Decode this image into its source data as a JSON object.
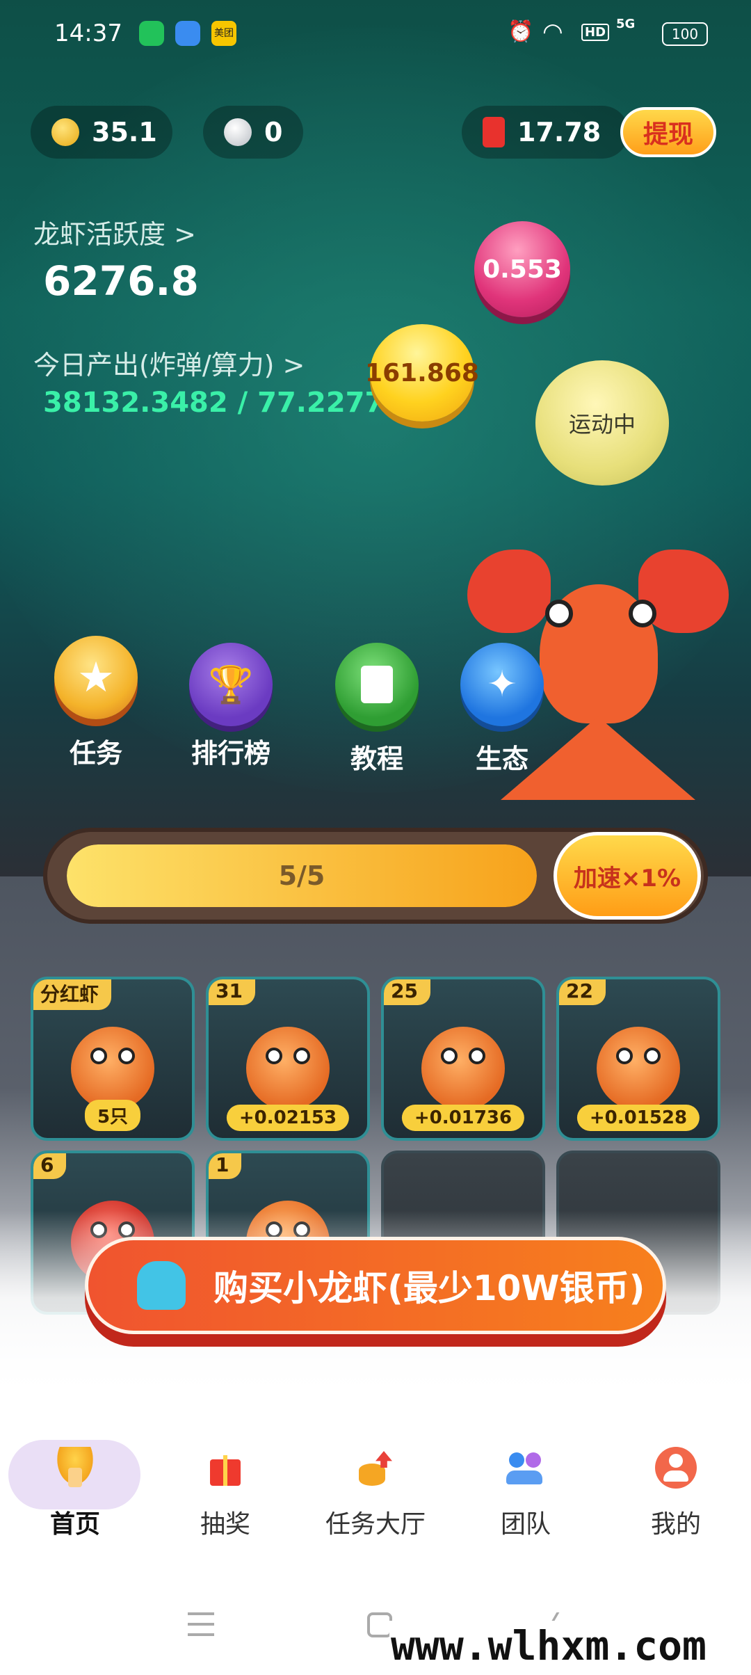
{
  "status_bar": {
    "time": "14:37",
    "app_icon_label": "美团",
    "battery": "100",
    "signal": "5G",
    "hd": "HD"
  },
  "wallet": {
    "gold": "35.1",
    "silver": "0",
    "redpacket": "17.78",
    "withdraw_label": "提现"
  },
  "stats": {
    "activity_label": "龙虾活跃度 >",
    "activity_value": "6276.8",
    "output_label": "今日产出(炸弹/算力) >",
    "output_value": "38132.3482 / 77.2277"
  },
  "bubbles": {
    "pink": "0.553",
    "yellow": "161.868",
    "status": "运动中"
  },
  "quick_actions": [
    {
      "label": "任务",
      "icon": "star-icon"
    },
    {
      "label": "排行榜",
      "icon": "trophy-icon"
    },
    {
      "label": "教程",
      "icon": "document-icon"
    },
    {
      "label": "生态",
      "icon": "sparkle-icon"
    }
  ],
  "progress": {
    "text": "5/5",
    "level": 1.0,
    "boost_label": "加速×1%"
  },
  "cards": [
    {
      "tag": "分红虾",
      "chip": "5只"
    },
    {
      "tag": "31",
      "chip": "+0.02153"
    },
    {
      "tag": "25",
      "chip": "+0.01736"
    },
    {
      "tag": "22",
      "chip": "+0.01528"
    },
    {
      "tag": "6",
      "chip": "+"
    },
    {
      "tag": "1",
      "chip": ""
    }
  ],
  "buy_button": {
    "label": "购买小龙虾(最少10W银币)"
  },
  "nav": [
    {
      "label": "首页",
      "icon": "home-mushroom-icon"
    },
    {
      "label": "抽奖",
      "icon": "gift-icon"
    },
    {
      "label": "任务大厅",
      "icon": "coins-icon"
    },
    {
      "label": "团队",
      "icon": "team-icon"
    },
    {
      "label": "我的",
      "icon": "profile-icon"
    }
  ],
  "watermark": "www.wlhxm.com",
  "colors": {
    "accent": "#f7a21b",
    "progress_start": "#fde26a",
    "progress_end": "#f7a21b",
    "buy_button": "#f0542f"
  }
}
